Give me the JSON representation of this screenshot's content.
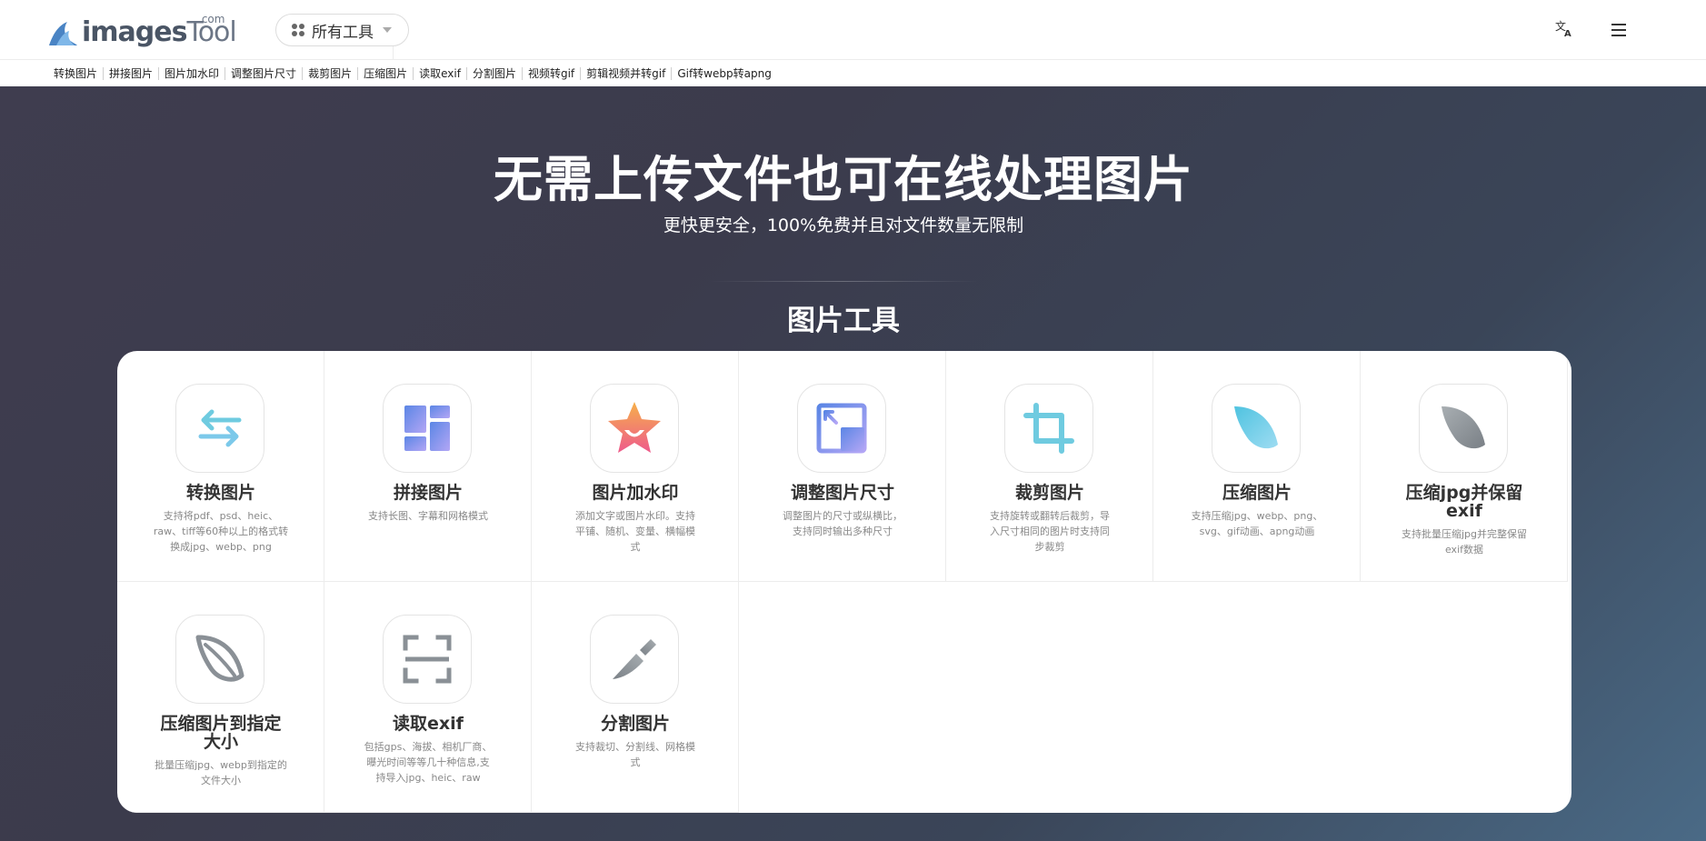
{
  "header": {
    "logo_main": "images",
    "logo_tool": "Tool",
    "logo_com": ".com",
    "all_tools_label": "所有工具",
    "lang_icon_glyph": "文A",
    "icons": {
      "logo": "wave-logo-icon",
      "all_tools": "grid-dots-icon",
      "dropdown": "chevron-down-icon",
      "language": "translate-icon",
      "menu": "hamburger-menu-icon"
    }
  },
  "quicknav": [
    "转换图片",
    "拼接图片",
    "图片加水印",
    "调整图片尺寸",
    "裁剪图片",
    "压缩图片",
    "读取exif",
    "分割图片",
    "视频转gif",
    "剪辑视频并转gif",
    "Gif转webp转apng"
  ],
  "hero": {
    "title": "无需上传文件也可在线处理图片",
    "subtitle": "更快更安全，100%免费并且对文件数量无限制",
    "section_title": "图片工具"
  },
  "colors": {
    "hero_bg_start": "#3f3d4f",
    "hero_bg_end": "#4a6a86",
    "accent_cyan": "#6fcbe0",
    "accent_purple": "#a79cf0",
    "accent_blue": "#6a8fe6",
    "icon_gray": "#8a9096"
  },
  "tools": [
    {
      "name": "转换图片",
      "desc": [
        "支持将pdf、psd、heic、",
        "raw、tiff等60种以上的格式转",
        "换成jpg、webp、png"
      ],
      "icon": "convert-arrows-icon"
    },
    {
      "name": "拼接图片",
      "desc": [
        "支持长图、字幕和网格模式"
      ],
      "icon": "collage-grid-icon"
    },
    {
      "name": "图片加水印",
      "desc": [
        "添加文字或图片水印。支持",
        "平铺、随机、变量、横幅模",
        "式"
      ],
      "icon": "watermark-star-icon"
    },
    {
      "name": "调整图片尺寸",
      "desc": [
        "调整图片的尺寸或纵横比，",
        "支持同时输出多种尺寸"
      ],
      "icon": "resize-image-icon"
    },
    {
      "name": "裁剪图片",
      "desc": [
        "支持旋转或翻转后裁剪，导",
        "入尺寸相同的图片时支持同",
        "步裁剪"
      ],
      "icon": "crop-icon"
    },
    {
      "name": "压缩图片",
      "desc": [
        "支持压缩jpg、webp、png、",
        "svg、gif动画、apng动画"
      ],
      "icon": "feather-compress-icon"
    },
    {
      "name_lines": [
        "压缩jpg并保留",
        "exif"
      ],
      "desc": [
        "支持批量压缩jpg并完整保留",
        "exif数据"
      ],
      "icon": "feather-gray-icon"
    },
    {
      "name_lines": [
        "压缩图片到指定",
        "大小"
      ],
      "desc": [
        "批量压缩jpg、webp到指定的",
        "文件大小"
      ],
      "icon": "feather-outline-icon"
    },
    {
      "name": "读取exif",
      "desc": [
        "包括gps、海拔、相机厂商、",
        "曝光时间等等几十种信息,支",
        "持导入jpg、heic、raw"
      ],
      "icon": "scan-frame-icon"
    },
    {
      "name": "分割图片",
      "desc": [
        "支持裁切、分割线、网格模",
        "式"
      ],
      "icon": "knife-split-icon"
    }
  ]
}
